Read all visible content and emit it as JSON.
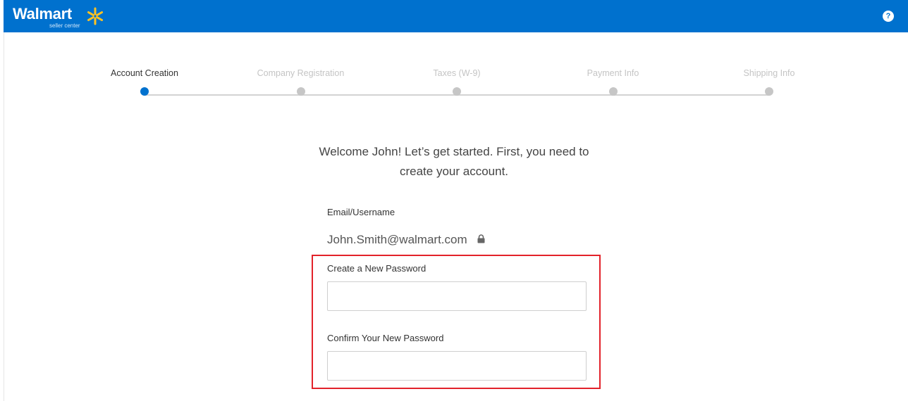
{
  "header": {
    "brand": "Walmart",
    "sub_brand": "seller center",
    "help_icon": "?",
    "brand_color": "#0071ce",
    "spark_color": "#ffc220"
  },
  "stepper": {
    "steps": [
      {
        "label": "Account Creation",
        "state": "active"
      },
      {
        "label": "Company Registration",
        "state": "inactive"
      },
      {
        "label": "Taxes (W-9)",
        "state": "inactive"
      },
      {
        "label": "Payment Info",
        "state": "inactive"
      },
      {
        "label": "Shipping Info",
        "state": "inactive"
      }
    ],
    "active_color": "#0071ce",
    "inactive_color": "#c6c6c6"
  },
  "main": {
    "welcome_line1": "Welcome John! Let’s get started. First, you need to",
    "welcome_line2": "create your account.",
    "email_label": "Email/Username",
    "email_value": "John.Smith@walmart.com",
    "email_locked_icon": "lock-icon",
    "new_password_label": "Create a New Password",
    "new_password_value": "",
    "confirm_password_label": "Confirm Your New Password",
    "confirm_password_value": "",
    "highlight_color": "#e2222a"
  }
}
